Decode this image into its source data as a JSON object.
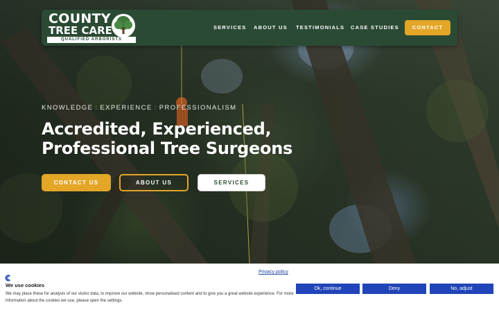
{
  "header": {
    "logo_line1": "COUNTY",
    "logo_line2": "TREE CARE",
    "logo_subtitle": "QUALIFIED ARBORISTS",
    "nav": [
      {
        "label": "SERVICES"
      },
      {
        "label": "ABOUT US"
      },
      {
        "label": "TESTIMONIALS"
      },
      {
        "label": "CASE STUDIES"
      }
    ],
    "contact_label": "CONTACT"
  },
  "hero": {
    "tagline": [
      "KNOWLEDGE",
      "EXPERIENCE",
      "PROFESSIONALISM"
    ],
    "tagline_separator": ":",
    "headline_line1": "Accredited, Experienced,",
    "headline_line2": "Professional Tree Surgeons",
    "buttons": {
      "contact": "CONTACT US",
      "about": "ABOUT US",
      "services": "SERVICES"
    }
  },
  "cookie_banner": {
    "privacy_link": "Privacy policy",
    "title": "We use cookies",
    "text": "We may place these for analysis of our visitor data, to improve our website, show personalised content and to give you a great website experience. For more information about the cookies we use, please open the settings.",
    "buttons": {
      "ok": "Ok, continue",
      "deny": "Deny",
      "adjust": "No, adjust"
    }
  },
  "colors": {
    "header_bg": "#2a4a34",
    "accent": "#e3a627",
    "cookie_button": "#2145b8",
    "link": "#1f3f9e"
  },
  "icons": {
    "logo": "oak-tree-icon",
    "cookie": "cookie-consent-icon"
  }
}
